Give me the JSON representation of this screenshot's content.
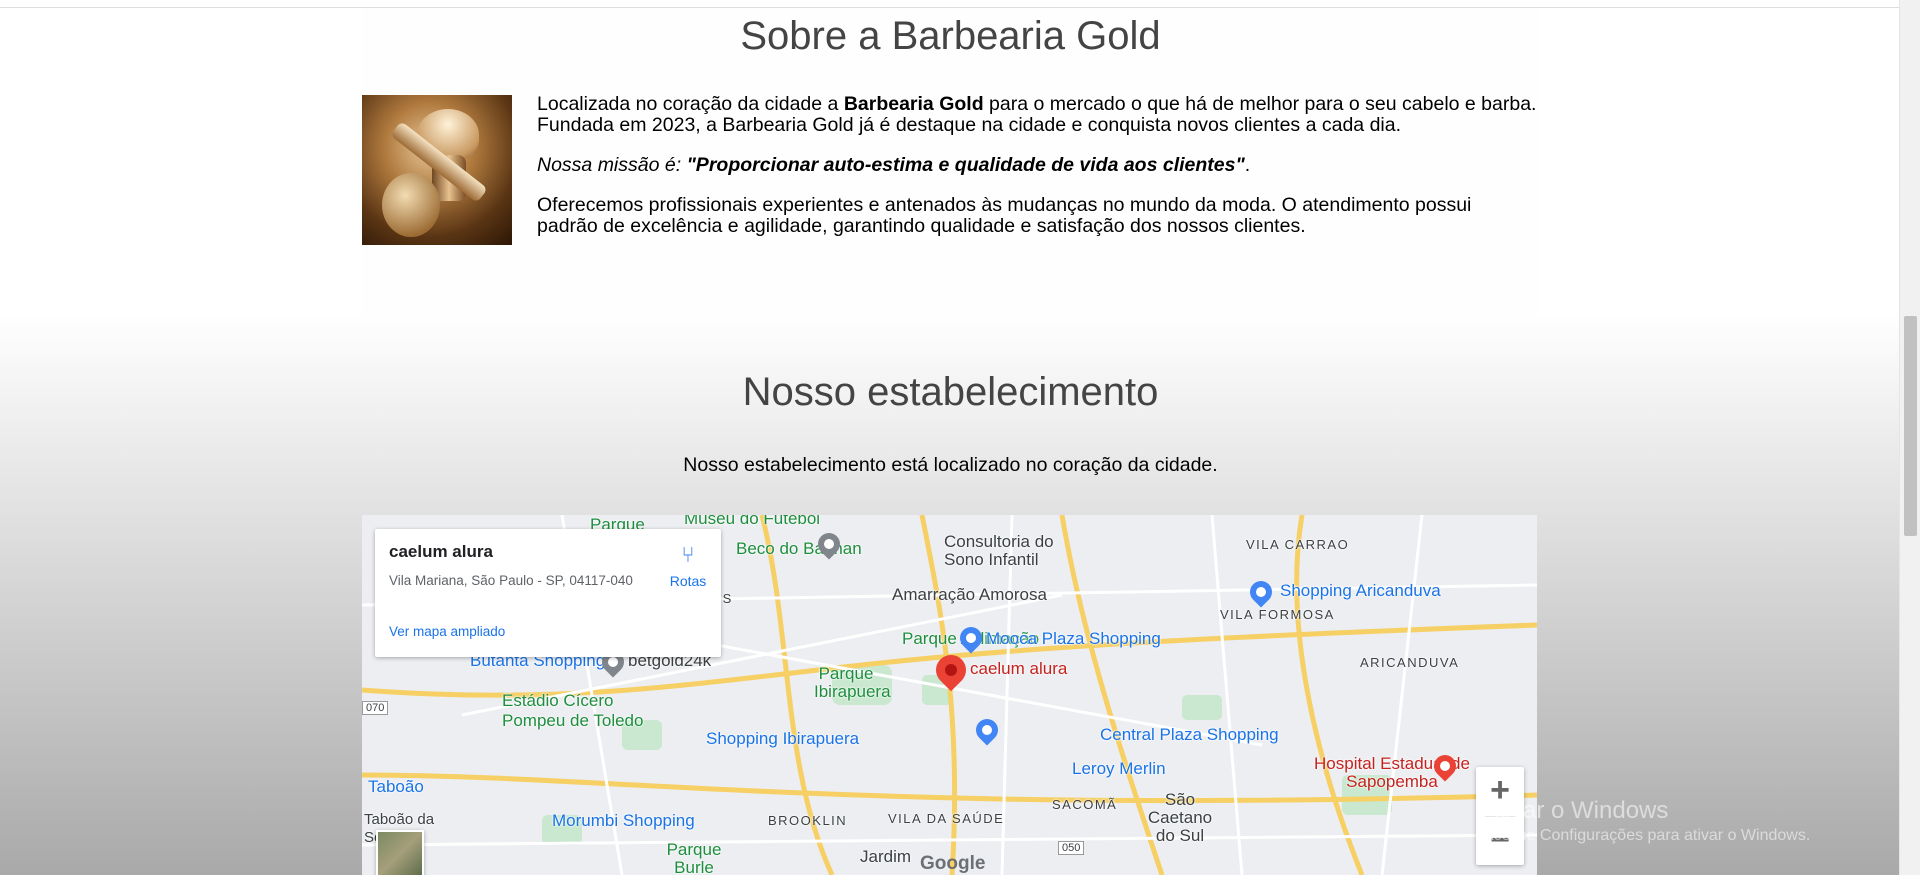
{
  "about": {
    "title": "Sobre a Barbearia Gold",
    "p1_prefix": "Localizada no coração da cidade a ",
    "p1_bold": "Barbearia Gold",
    "p1_suffix": " para o mercado o que há de melhor para o seu cabelo e barba. Fundada em 2023, a Barbearia Gold já é destaque na cidade e conquista novos clientes a cada dia.",
    "p2_prefix": "Nossa missão é: ",
    "p2_bold": "\"Proporcionar auto-estima e qualidade de vida aos clientes\"",
    "p2_suffix": ".",
    "p3": "Oferecemos profissionais experientes e antenados às mudanças no mundo da moda. O atendimento possui padrão de excelência e agilidade, garantindo qualidade e satisfação dos nossos clientes."
  },
  "establishment": {
    "title": "Nosso estabelecimento",
    "lead": "Nosso estabelecimento está localizado no coração da cidade."
  },
  "map": {
    "card": {
      "name": "caelum alura",
      "address": "Vila Mariana, São Paulo - SP, 04117-040",
      "directions": "Rotas",
      "larger_map": "Ver mapa ampliado"
    },
    "labels": {
      "museu": "Museu do Futebol",
      "parque_top": "Parque",
      "beco": "Beco do Batman",
      "consultoria": "Consultoria do Sono Infantil",
      "vila_carrao": "VILA CARRAO",
      "shopping_aricanduva": "Shopping Aricanduva",
      "vila_formosa": "VILA FORMOSA",
      "inheiros": "INHEIROS",
      "amarracao": "Amarração Amorosa",
      "parque_aclimacao": "Parque Aclimação",
      "mooca": "Mooca Plaza Shopping",
      "aricanduva": "ARICANDUVA",
      "butanta": "Butantã Shopping",
      "betgold": "betgold24k",
      "parque_ibirapuera": "Parque Ibirapuera",
      "caelum_pin": "caelum alura",
      "estadio": "Estádio Cícero Pompeu de Toledo",
      "shopping_ibirapuera": "Shopping Ibirapuera",
      "central_plaza": "Central Plaza Shopping",
      "leroy": "Leroy Merlin",
      "hospital": "Hospital Estadual de Sapopemba",
      "taboao": "Taboão",
      "morumbi": "Morumbi Shopping",
      "brooklin": "BROOKLIN",
      "vila_saude": "VILA DA SAÚDE",
      "sacoma": "SACOMÃ",
      "sao_caetano": "São Caetano do Sul",
      "parque_burle": "Parque Burle Marx",
      "jardim": "Jardim",
      "google": "Google",
      "taboao_serra": "Taboão da Serra",
      "road_050": "050",
      "road_070": "070"
    },
    "zoom_in": "+",
    "zoom_out": "−"
  },
  "watermark": {
    "title": "Ativar o Windows",
    "subtitle": "Acesse Configurações para ativar o Windows."
  },
  "colors": {
    "park_green": "#1e8e3e",
    "shop_blue": "#1a73e8",
    "pin_red": "#ea4335",
    "heading": "#444444"
  }
}
